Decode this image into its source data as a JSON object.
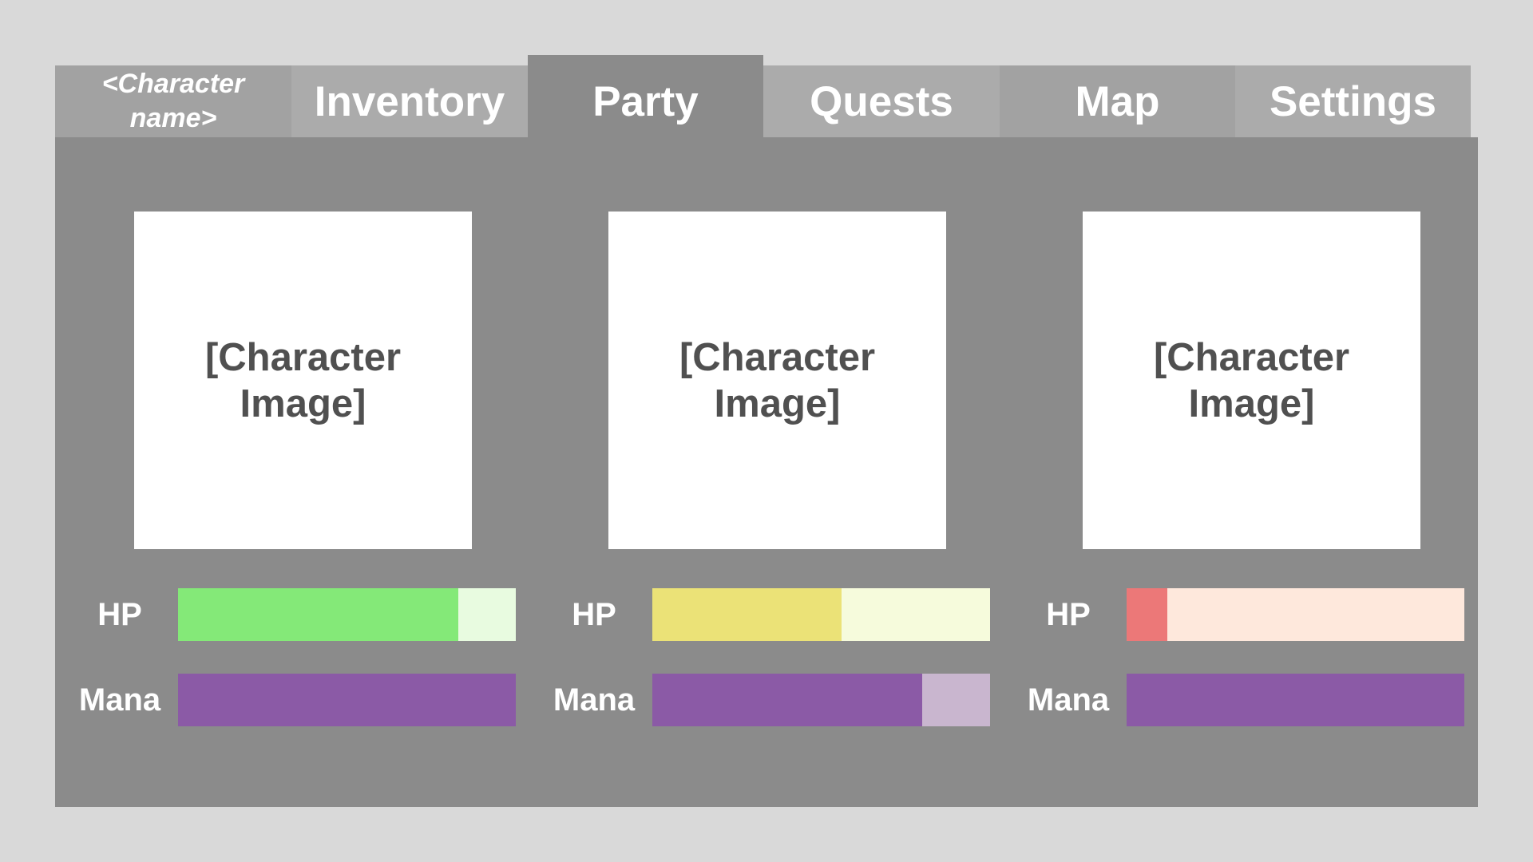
{
  "tabs": [
    {
      "id": "character",
      "label": "<Character name>",
      "state": "normal"
    },
    {
      "id": "inventory",
      "label": "Inventory",
      "state": "normal"
    },
    {
      "id": "party",
      "label": "Party",
      "state": "active"
    },
    {
      "id": "quests",
      "label": "Quests",
      "state": "normal"
    },
    {
      "id": "map",
      "label": "Map",
      "state": "normal"
    },
    {
      "id": "settings",
      "label": "Settings",
      "state": "normal"
    }
  ],
  "party": {
    "members": [
      {
        "image_placeholder": "[Character Image]",
        "hp": {
          "label": "HP",
          "fraction": 0.83,
          "fill_color": "#84e978",
          "track_color": "#e8fbe0"
        },
        "mana": {
          "label": "Mana",
          "fraction": 1.0,
          "fill_color": "#8b5aa6",
          "track_color": "#c9b6cf"
        }
      },
      {
        "image_placeholder": "[Character Image]",
        "hp": {
          "label": "HP",
          "fraction": 0.56,
          "fill_color": "#ebe277",
          "track_color": "#f6fbdc"
        },
        "mana": {
          "label": "Mana",
          "fraction": 0.8,
          "fill_color": "#8b5aa6",
          "track_color": "#c9b6cf"
        }
      },
      {
        "image_placeholder": "[Character Image]",
        "hp": {
          "label": "HP",
          "fraction": 0.12,
          "fill_color": "#ec7878",
          "track_color": "#fee8dc"
        },
        "mana": {
          "label": "Mana",
          "fraction": 1.0,
          "fill_color": "#8b5aa6",
          "track_color": "#c9b6cf"
        }
      }
    ]
  },
  "colors": {
    "background": "#d9d9d9",
    "panel": "#8b8b8b",
    "tab_inactive": "#ababab",
    "tab_active": "#8b8b8b"
  }
}
